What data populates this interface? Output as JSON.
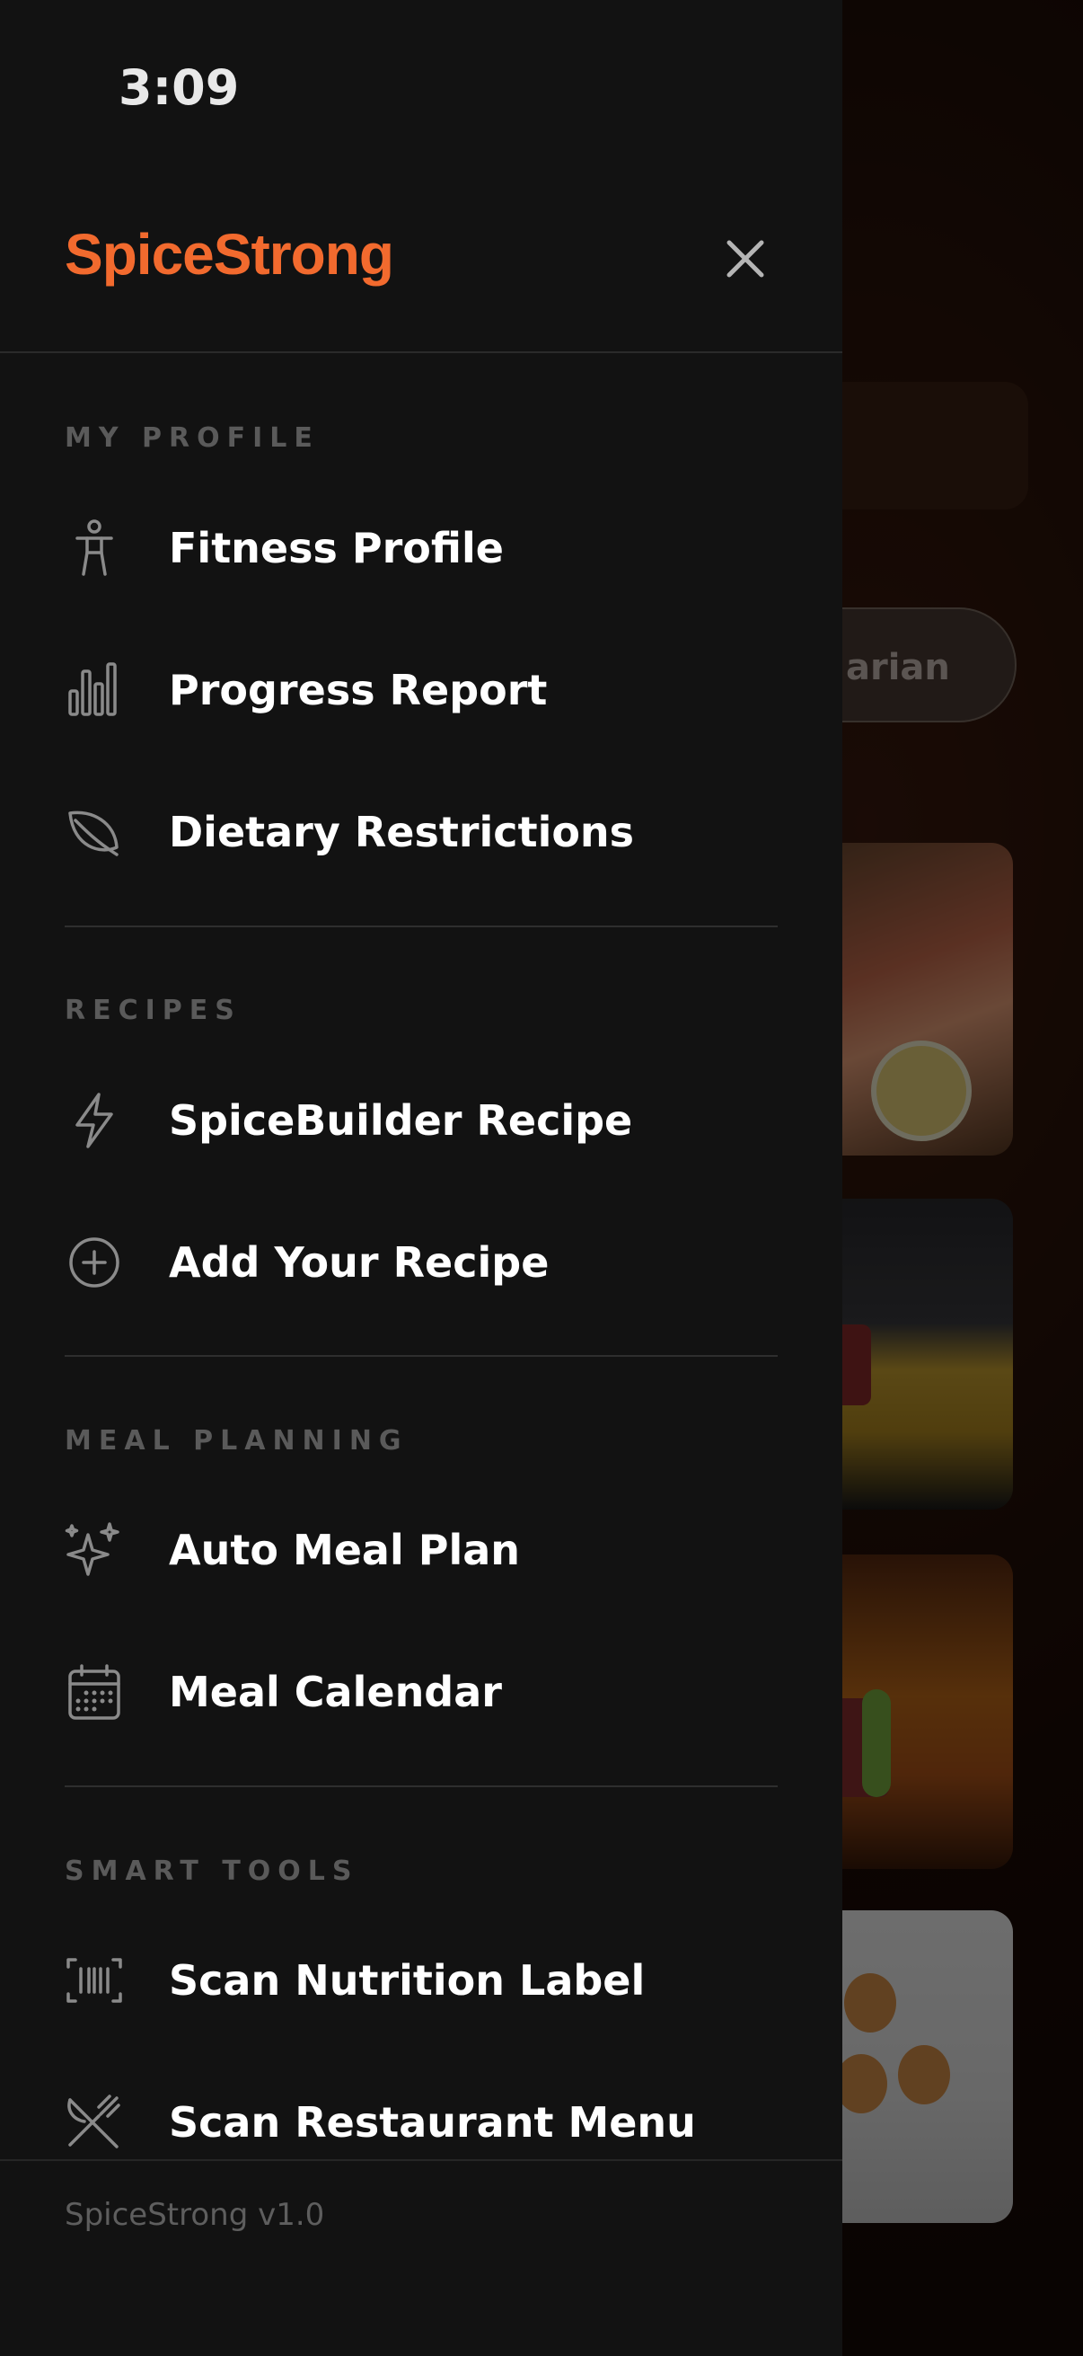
{
  "status_bar": {
    "time": "3:09"
  },
  "drawer": {
    "brand": "SpiceStrong",
    "close_icon": "close-icon",
    "sections": [
      {
        "title": "MY PROFILE",
        "items": [
          {
            "label": "Fitness Profile",
            "icon": "person-icon"
          },
          {
            "label": "Progress Report",
            "icon": "bar-chart-icon"
          },
          {
            "label": "Dietary Restrictions",
            "icon": "leaf-icon"
          }
        ]
      },
      {
        "title": "RECIPES",
        "items": [
          {
            "label": "SpiceBuilder Recipe",
            "icon": "lightning-icon"
          },
          {
            "label": "Add Your Recipe",
            "icon": "plus-circle-icon"
          }
        ]
      },
      {
        "title": "MEAL PLANNING",
        "items": [
          {
            "label": "Auto Meal Plan",
            "icon": "sparkles-icon"
          },
          {
            "label": "Meal Calendar",
            "icon": "calendar-icon"
          }
        ]
      },
      {
        "title": "SMART TOOLS",
        "items": [
          {
            "label": "Scan Nutrition Label",
            "icon": "barcode-icon"
          },
          {
            "label": "Scan Restaurant Menu",
            "icon": "utensils-icon"
          }
        ]
      }
    ],
    "footer": {
      "version": "SpiceStrong v1.0"
    }
  },
  "background": {
    "filter_chip_visible_text": "arian"
  },
  "colors": {
    "brand_orange": "#f26a2e",
    "drawer_bg": "#121212",
    "section_label": "#5a5a5a",
    "icon_stroke": "#8a8a8a"
  }
}
